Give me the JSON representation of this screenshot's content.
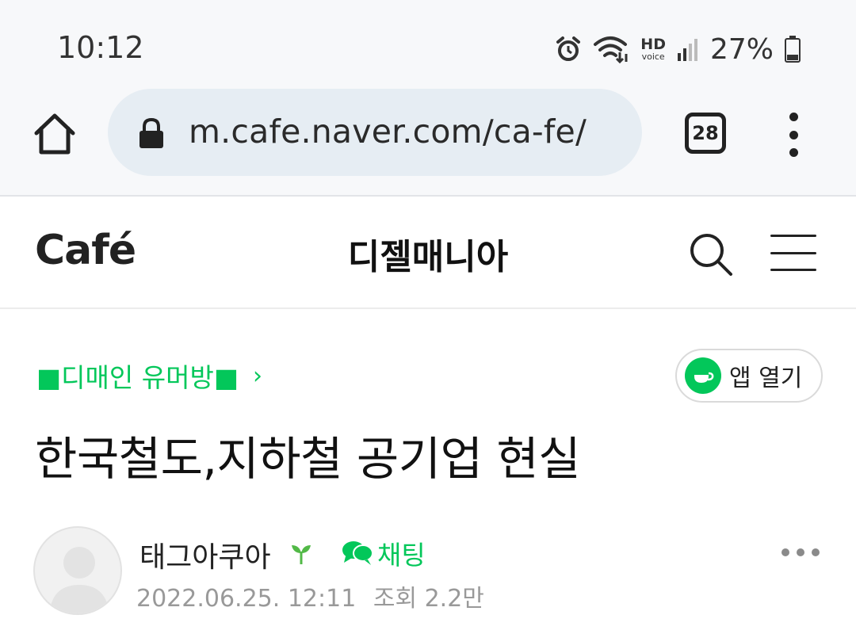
{
  "status_bar": {
    "time": "10:12",
    "network_label": "HD",
    "network_sub": "voice",
    "battery": "27%"
  },
  "browser": {
    "url": "m.cafe.naver.com/ca-fe/",
    "tab_count": "28"
  },
  "cafe_header": {
    "logo": "Café",
    "cafe_name": "디젤매니아"
  },
  "article": {
    "board_name": "■디매인 유머방■",
    "board_chevron": "›",
    "open_app_label": "앱 열기",
    "title": "한국철도,지하철 공기업 현실",
    "author": "태그아쿠아",
    "chat_label": "채팅",
    "date": "2022.06.25. 12:11",
    "views": "조회 2.2만"
  },
  "colors": {
    "accent": "#03c75a",
    "status_bg": "#f7f8fa",
    "url_bar_bg": "#e6edf3"
  },
  "icons": [
    "alarm-icon",
    "wifi-icon",
    "signal-icon",
    "battery-icon",
    "home-icon",
    "lock-icon",
    "menu-icon",
    "search-icon",
    "hamburger-icon",
    "coffee-cup-icon",
    "sprout-icon",
    "chat-icon",
    "more-icon"
  ]
}
